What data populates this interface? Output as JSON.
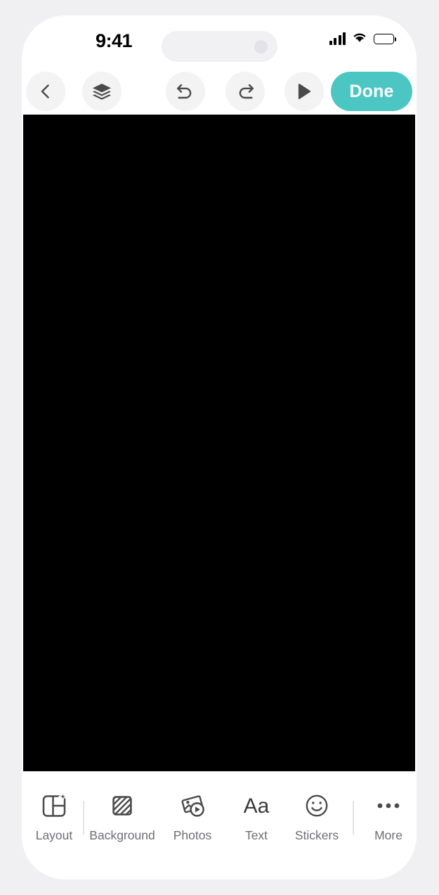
{
  "status_bar": {
    "time": "9:41",
    "signal_icon": "cellular-signal-icon",
    "signal_bars_filled": 4,
    "wifi_icon": "wifi-icon",
    "battery_icon": "battery-full-icon",
    "battery_level_percent": 100
  },
  "toolbar": {
    "back_label": "back-chevron",
    "layers_label": "layers",
    "undo_label": "undo",
    "redo_label": "redo",
    "play_label": "play",
    "done_label": "Done",
    "done_color": "#4cc6c2"
  },
  "canvas": {
    "background_color": "#000000"
  },
  "bottom_bar": {
    "items": [
      {
        "label": "Layout",
        "icon": "layout-grid-sparkle-icon"
      },
      {
        "label": "Background",
        "icon": "diagonal-hatch-square-icon"
      },
      {
        "label": "Photos",
        "icon": "photo-play-icon"
      },
      {
        "label": "Text",
        "icon": "text-aa-icon"
      },
      {
        "label": "Stickers",
        "icon": "smiley-face-icon"
      },
      {
        "label": "More",
        "icon": "ellipsis-icon"
      }
    ],
    "label_color": "#6e6e73",
    "icon_color": "#4a4a4a"
  }
}
